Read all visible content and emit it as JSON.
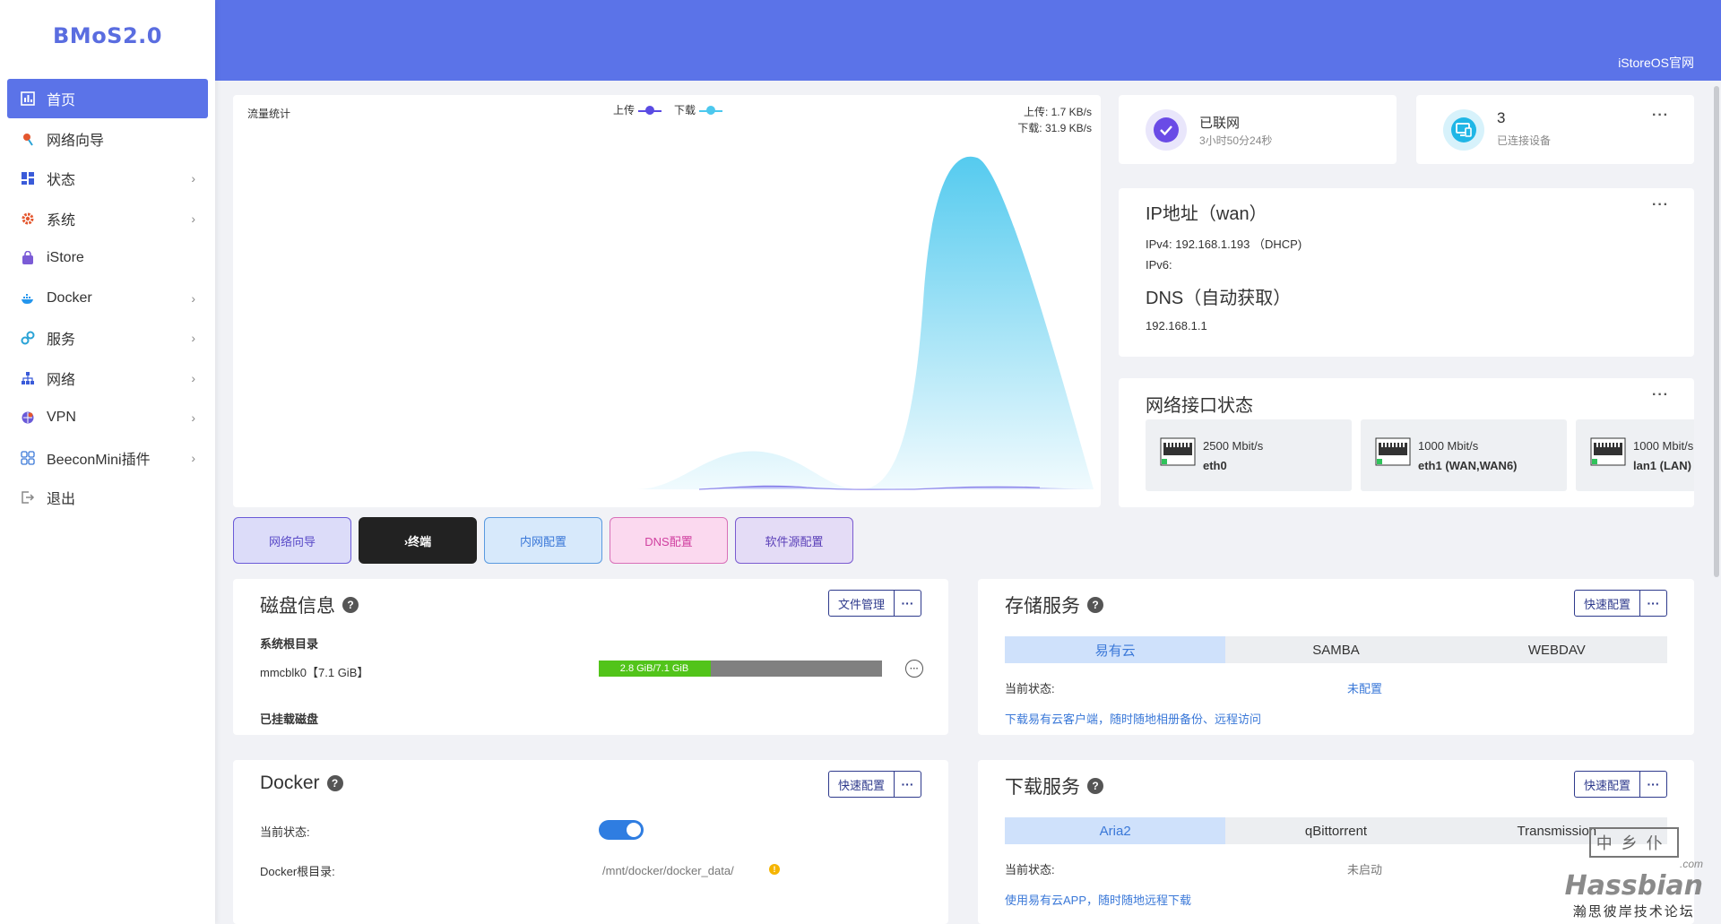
{
  "app": {
    "logo": "BMoS2.0",
    "official_link": "iStoreOS官网"
  },
  "sidebar": {
    "items": [
      {
        "label": "首页",
        "icon": "dashboard-icon",
        "active": true,
        "has_children": false
      },
      {
        "label": "网络向导",
        "icon": "wizard-icon",
        "active": false,
        "has_children": false
      },
      {
        "label": "状态",
        "icon": "status-icon",
        "active": false,
        "has_children": true
      },
      {
        "label": "系统",
        "icon": "gear-icon",
        "active": false,
        "has_children": true
      },
      {
        "label": "iStore",
        "icon": "store-icon",
        "active": false,
        "has_children": false
      },
      {
        "label": "Docker",
        "icon": "docker-icon",
        "active": false,
        "has_children": true
      },
      {
        "label": "服务",
        "icon": "services-icon",
        "active": false,
        "has_children": true
      },
      {
        "label": "网络",
        "icon": "network-icon",
        "active": false,
        "has_children": true
      },
      {
        "label": "VPN",
        "icon": "vpn-icon",
        "active": false,
        "has_children": true
      },
      {
        "label": "BeeconMini插件",
        "icon": "plugin-icon",
        "active": false,
        "has_children": true
      },
      {
        "label": "退出",
        "icon": "logout-icon",
        "active": false,
        "has_children": false
      }
    ],
    "chevron": "›"
  },
  "traffic": {
    "title": "流量统计",
    "legend_up": "上传",
    "legend_down": "下载",
    "rate_up": "上传: 1.7 KB/s",
    "rate_down": "下载: 31.9 KB/s"
  },
  "status": {
    "network_state": "已联网",
    "uptime": "3小时50分24秒",
    "device_count": "3",
    "device_label": "已连接设备",
    "more": "···"
  },
  "ip": {
    "title": "IP地址（wan）",
    "ipv4": "IPv4: 192.168.1.193 （DHCP)",
    "ipv6": "IPv6:",
    "dns_title": "DNS（自动获取）",
    "dns_value": "192.168.1.1"
  },
  "interfaces": {
    "title": "网络接口状态",
    "items": [
      {
        "speed": "2500 Mbit/s",
        "name": "eth0"
      },
      {
        "speed": "1000 Mbit/s",
        "name": "eth1 (WAN,WAN6)"
      },
      {
        "speed": "1000 Mbit/s",
        "name": "lan1 (LAN)"
      }
    ]
  },
  "quick_buttons": [
    {
      "label": "网络向导"
    },
    {
      "label": "›终端"
    },
    {
      "label": "内网配置"
    },
    {
      "label": "DNS配置"
    },
    {
      "label": "软件源配置"
    }
  ],
  "disk": {
    "title": "磁盘信息",
    "help": "?",
    "file_manager": "文件管理",
    "more": "···",
    "root_label": "系统根目录",
    "device": "mmcblk0【7.1 GiB】",
    "usage_text": "2.8 GiB/7.1 GiB",
    "usage_fraction": 0.394,
    "mounted_label": "已挂载磁盘",
    "row_more": "···"
  },
  "storage": {
    "title": "存储服务",
    "help": "?",
    "config_button": "快速配置",
    "more": "···",
    "tabs": [
      "易有云",
      "SAMBA",
      "WEBDAV"
    ],
    "active_tab": 0,
    "state_label": "当前状态:",
    "state_value": "未配置",
    "link": "下载易有云客户端，随时随地相册备份、远程访问"
  },
  "docker": {
    "title": "Docker",
    "help": "?",
    "config_button": "快速配置",
    "more": "···",
    "state_label": "当前状态:",
    "enabled": true,
    "root_label": "Docker根目录:",
    "root_path": "/mnt/docker/docker_data/",
    "warn": "!"
  },
  "download": {
    "title": "下载服务",
    "help": "?",
    "config_button": "快速配置",
    "more": "···",
    "tabs": [
      "Aria2",
      "qBittorrent",
      "Transmission"
    ],
    "active_tab": 0,
    "state_label": "当前状态:",
    "state_value": "未启动",
    "link": "使用易有云APP，随时随地远程下载"
  },
  "watermark": {
    "stamp": "中乡仆",
    "domain": ".com",
    "brand": "Hassbian",
    "slogan": "瀚思彼岸技术论坛"
  },
  "colors": {
    "accent": "#5b73e8",
    "upload": "#5a4be3",
    "download": "#4cc8ee",
    "disk_used": "#52c41a",
    "disk_free": "#808080"
  }
}
